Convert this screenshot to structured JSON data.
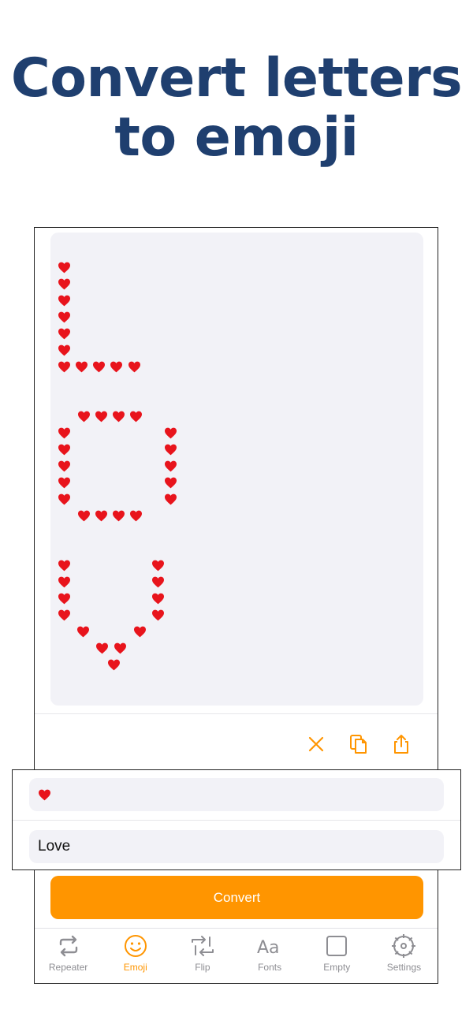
{
  "headline": {
    "line1": "Convert letters",
    "line2": "to emoji"
  },
  "output": {
    "emoji": "❤️"
  },
  "inputs": {
    "emoji_value": "❤️",
    "text_value": "Love"
  },
  "actions": {
    "clear_icon": "x-icon",
    "copy_icon": "copy-icon",
    "share_icon": "share-icon"
  },
  "convert_label": "Convert",
  "tabs": [
    {
      "label": "Repeater",
      "icon": "repeat-icon",
      "active": false
    },
    {
      "label": "Emoji",
      "icon": "smiley-icon",
      "active": true
    },
    {
      "label": "Flip",
      "icon": "flip-icon",
      "active": false
    },
    {
      "label": "Fonts",
      "icon": "fonts-icon",
      "active": false
    },
    {
      "label": "Empty",
      "icon": "square-icon",
      "active": false
    },
    {
      "label": "Settings",
      "icon": "gear-icon",
      "active": false
    }
  ],
  "colors": {
    "accent": "#ff9500",
    "headline": "#1f3f6f",
    "heart": "#e8141c",
    "inactive": "#8e8e93"
  }
}
